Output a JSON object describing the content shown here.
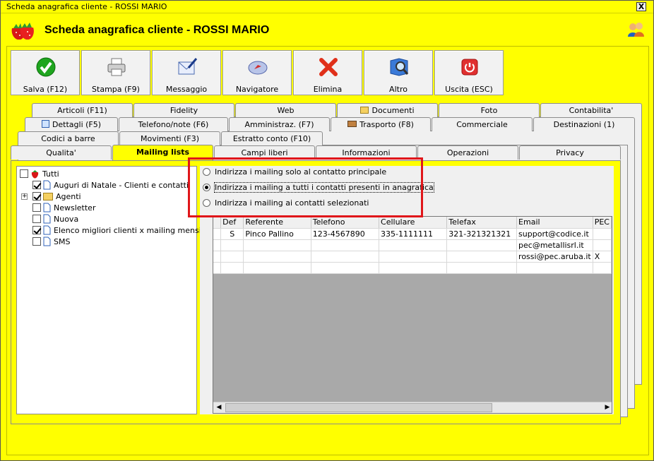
{
  "window": {
    "title": "Scheda anagrafica cliente - ROSSI MARIO",
    "close_label": "X"
  },
  "header": {
    "title": "Scheda anagrafica cliente - ROSSI MARIO"
  },
  "toolbar": [
    {
      "label": "Salva (F12)",
      "icon": "check-icon"
    },
    {
      "label": "Stampa (F9)",
      "icon": "printer-icon"
    },
    {
      "label": "Messaggio",
      "icon": "envelope-icon"
    },
    {
      "label": "Navigatore",
      "icon": "compass-icon"
    },
    {
      "label": "Elimina",
      "icon": "delete-x-icon"
    },
    {
      "label": "Altro",
      "icon": "search-book-icon"
    },
    {
      "label": "Uscita (ESC)",
      "icon": "power-icon"
    }
  ],
  "tabs": {
    "row1": [
      "Articoli (F11)",
      "Fidelity",
      "Web",
      "Documenti",
      "Foto",
      "Contabilita'"
    ],
    "row2": [
      "Dettagli (F5)",
      "Telefono/note (F6)",
      "Amministraz. (F7)",
      "Trasporto (F8)",
      "Commerciale",
      "Destinazioni (1)"
    ],
    "row3": [
      "Codici a barre",
      "Movimenti (F3)",
      "Estratto conto (F10)"
    ],
    "row4": [
      "Qualita'",
      "Mailing lists",
      "Campi liberi",
      "Informazioni",
      "Operazioni",
      "Privacy"
    ]
  },
  "tree": {
    "root": "Tutti",
    "items": [
      {
        "label": "Auguri di Natale - Clienti e contatti",
        "checked": true
      },
      {
        "label": "Agenti",
        "checked": true
      },
      {
        "label": "Newsletter",
        "checked": false
      },
      {
        "label": "Nuova",
        "checked": false
      },
      {
        "label": "Elenco migliori clienti x mailing mensile",
        "checked": true
      },
      {
        "label": "SMS",
        "checked": false
      }
    ]
  },
  "options": [
    {
      "label": "Indirizza i mailing solo al contatto principale",
      "selected": false
    },
    {
      "label": "Indirizza i mailing a tutti i contatti presenti in anagrafica",
      "selected": true
    },
    {
      "label": "Indirizza i mailing ai contatti selezionati",
      "selected": false
    }
  ],
  "grid": {
    "columns": [
      "Def",
      "Referente",
      "Telefono",
      "Cellulare",
      "Telefax",
      "Email",
      "PEC"
    ],
    "rows": [
      [
        "S",
        "Pinco Pallino",
        "123-4567890",
        "335-1111111",
        "321-321321321",
        "support@codice.it",
        ""
      ],
      [
        "",
        "",
        "",
        "",
        "",
        "pec@metallisrl.it",
        ""
      ],
      [
        "",
        "",
        "",
        "",
        "",
        "rossi@pec.aruba.it",
        "X"
      ],
      [
        "",
        "",
        "",
        "",
        "",
        "",
        ""
      ]
    ]
  },
  "colors": {
    "background": "#ffff00",
    "highlight_border": "#e0161a"
  }
}
